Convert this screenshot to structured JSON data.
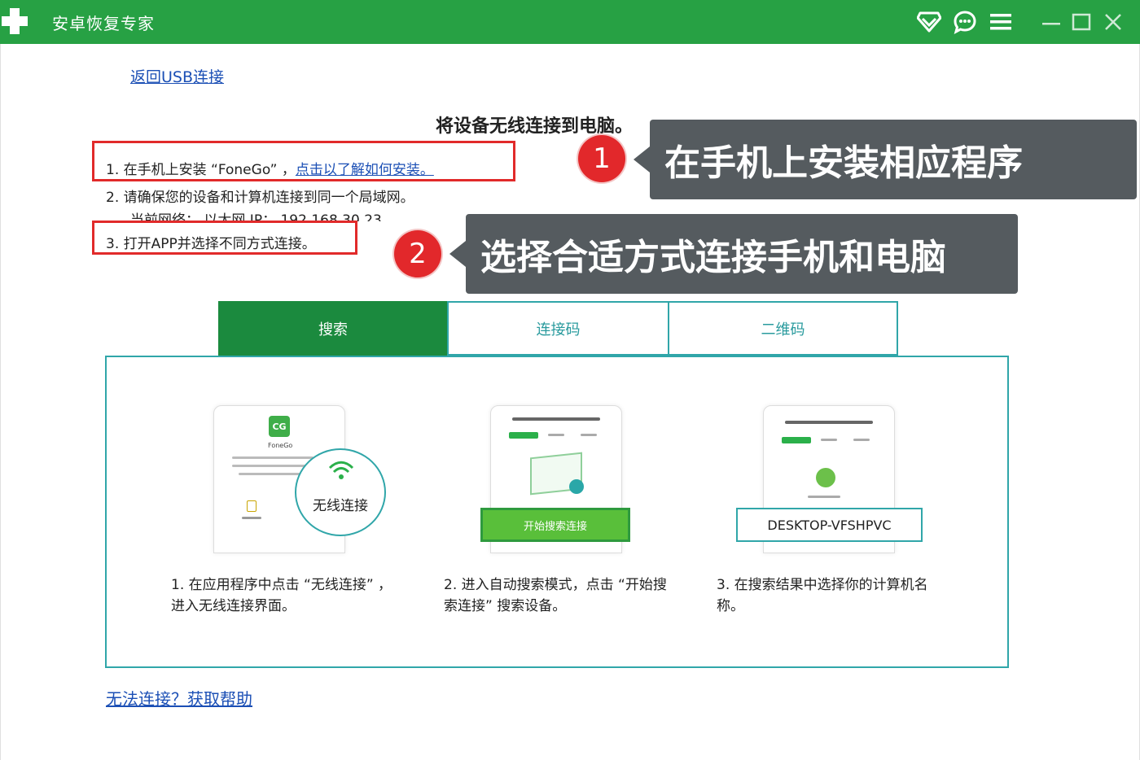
{
  "window": {
    "title": "安卓恢复专家"
  },
  "back_link": "返回USB连接",
  "main_title": "将设备无线连接到电脑。",
  "steps": {
    "step1_prefix": "1.  在手机上安装 “FoneGo” ，",
    "step1_link": "点击以了解如何安装。",
    "step2": "2.  请确保您的设备和计算机连接到同一个局域网。",
    "network": "当前网络：  以太网      IP：  192.168.30.23",
    "step3": "3.  打开APP并选择不同方式连接。"
  },
  "annotations": [
    {
      "number": "1",
      "text": "在手机上安装相应程序"
    },
    {
      "number": "2",
      "text": "选择合适方式连接手机和电脑"
    }
  ],
  "tabs": [
    {
      "label": "搜索",
      "active": true
    },
    {
      "label": "连接码",
      "active": false
    },
    {
      "label": "二维码",
      "active": false
    }
  ],
  "cards": [
    {
      "app_name": "FoneGo",
      "circle_label": "无线连接",
      "caption": "1.  在应用程序中点击 “无线连接” ，进入无线连接界面。"
    },
    {
      "button_label": "开始搜索连接",
      "caption": "2.  进入自动搜索模式，点击 “开始搜索连接” 搜索设备。"
    },
    {
      "device_name": "DESKTOP-VFSHPVC",
      "caption": "3.  在搜索结果中选择你的计算机名称。"
    }
  ],
  "help_link": "无法连接？获取帮助",
  "colors": {
    "titlebar": "#27a144",
    "tab_active": "#1b8a3e",
    "teal_border": "#30a6a9",
    "highlight_red": "#e12a2a",
    "callout_bg": "#555b5f",
    "link": "#1b4fb5"
  },
  "icons": [
    "app-logo-icon",
    "vip-diamond-icon",
    "chat-icon",
    "menu-icon",
    "minimize-icon",
    "maximize-icon",
    "close-icon",
    "wifi-icon"
  ]
}
